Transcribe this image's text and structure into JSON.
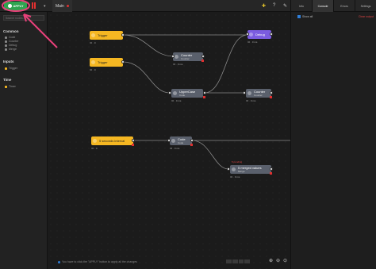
{
  "topbar": {
    "apply_label": "APPLY",
    "tab_label": "Main"
  },
  "right_tabs": [
    "Info",
    "Console",
    "Errors",
    "Settings"
  ],
  "left_panel": {
    "search_placeholder": "Search nodes...",
    "sections": [
      {
        "title": "Common",
        "items": [
          "Code",
          "Counter",
          "Debug",
          "Merge"
        ]
      },
      {
        "title": "Inputs",
        "items": [
          "Trigger"
        ]
      },
      {
        "title": "Time",
        "items": [
          "Timer"
        ]
      }
    ]
  },
  "nodes": {
    "trigger1": {
      "label": "Trigger",
      "meta": "IO · 0"
    },
    "trigger2": {
      "label": "Trigger",
      "meta": "IO · 0"
    },
    "counter1": {
      "label": "Counter",
      "sub": "Counter",
      "meta": "IO · 0 ms"
    },
    "uppercase": {
      "label": "UpperCase",
      "sub": "Code",
      "meta": "IO · 0 ms"
    },
    "debug": {
      "label": "Debug",
      "meta": "IO · 0 ms"
    },
    "counter2": {
      "label": "Counter",
      "sub": "Counter",
      "meta": "IO · 0 ms"
    },
    "timer": {
      "label": "5 seconds interval",
      "meta": "IO · 0"
    },
    "code": {
      "label": "Code",
      "sub": "Code",
      "meta": "IO · 0 ms"
    },
    "merge": {
      "label": "5 merged values",
      "sub": "Merge",
      "meta": "IO · 0 ms",
      "tag": "5 pending"
    }
  },
  "right_panel": {
    "checkbox_label": "Show all",
    "clear_label": "Clear output"
  },
  "hint": "You have to click the \"APPLY\" button to apply all the changes",
  "colors": {
    "apply": "#2ea44f",
    "trigger": "#f5b722",
    "code": "#5a606c",
    "debug": "#7b5ce0",
    "annotation": "#e8407a"
  }
}
